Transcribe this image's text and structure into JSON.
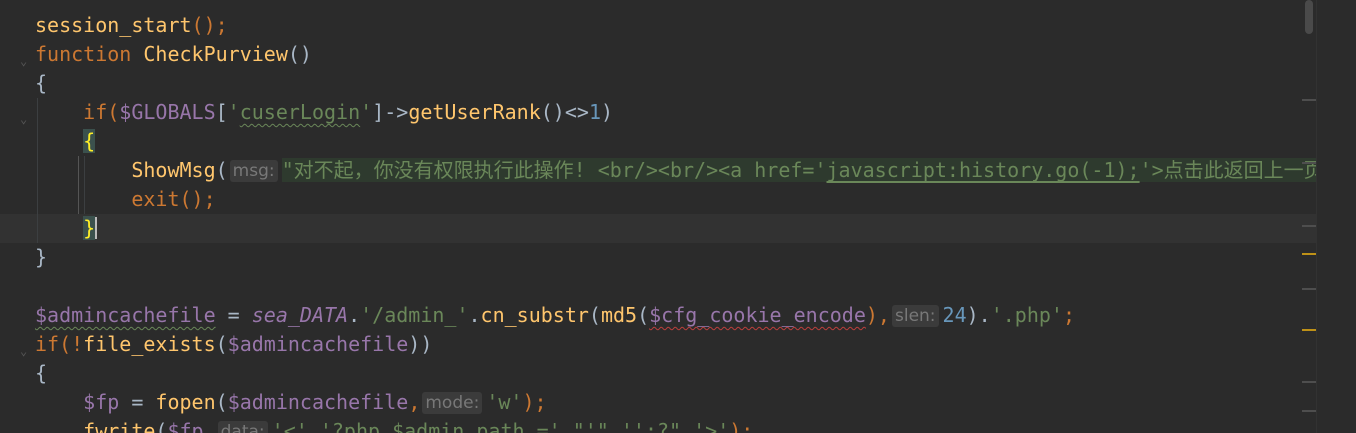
{
  "editor": {
    "lines": [
      {
        "tokens": [
          {
            "t": "session_start",
            "c": "fn"
          },
          {
            "t": "();",
            "c": "kw"
          }
        ]
      },
      {
        "tokens": [
          {
            "t": "function ",
            "c": "kw"
          },
          {
            "t": "CheckPurview",
            "c": "fn"
          },
          {
            "t": "()",
            "c": "pl"
          }
        ]
      },
      {
        "tokens": [
          {
            "t": "{",
            "c": "pl"
          }
        ]
      },
      {
        "tokens": [
          {
            "t": "    if(",
            "c": "kw"
          },
          {
            "t": "$GLOBALS",
            "c": "var"
          },
          {
            "t": "[",
            "c": "pl"
          },
          {
            "t": "'",
            "c": "str"
          },
          {
            "t": "cuserLogin",
            "c": "str squig"
          },
          {
            "t": "'",
            "c": "str"
          },
          {
            "t": "]->",
            "c": "pl"
          },
          {
            "t": "getUserRank",
            "c": "fn"
          },
          {
            "t": "()<>",
            "c": "pl"
          },
          {
            "t": "1",
            "c": "num"
          },
          {
            "t": ")",
            "c": "pl"
          }
        ]
      },
      {
        "tokens": [
          {
            "t": "    ",
            "c": "pl"
          },
          {
            "t": "{",
            "c": "brace-hl"
          }
        ]
      },
      {
        "tokens": [
          {
            "t": "        ShowMsg",
            "c": "fn"
          },
          {
            "t": "(",
            "c": "pl"
          },
          {
            "hint": "msg:"
          },
          {
            "t": "\"对不起，你没有权限执行此操作! <br/><br/><a href='",
            "c": "str strbg"
          },
          {
            "t": "javascript:history.go(-1);",
            "c": "str strbg uline"
          },
          {
            "t": "'>点击此返回上一页",
            "c": "str strbg"
          }
        ]
      },
      {
        "tokens": [
          {
            "t": "        exit",
            "c": "kw"
          },
          {
            "t": "();",
            "c": "kw"
          }
        ]
      },
      {
        "tokens": [
          {
            "t": "    ",
            "c": "pl"
          },
          {
            "t": "}",
            "c": "brace-hl"
          },
          {
            "caret": true
          }
        ],
        "current": true
      },
      {
        "tokens": [
          {
            "t": "}",
            "c": "pl"
          }
        ]
      },
      {
        "tokens": []
      },
      {
        "tokens": [
          {
            "t": "$admincachefile",
            "c": "var squig"
          },
          {
            "t": " = ",
            "c": "pl"
          },
          {
            "t": "sea_DATA",
            "c": "var italic"
          },
          {
            "t": ".",
            "c": "pl"
          },
          {
            "t": "'/admin_'",
            "c": "str"
          },
          {
            "t": ".",
            "c": "pl"
          },
          {
            "t": "cn_substr",
            "c": "fn"
          },
          {
            "t": "(",
            "c": "pl"
          },
          {
            "t": "md5",
            "c": "fn"
          },
          {
            "t": "(",
            "c": "pl"
          },
          {
            "t": "$cfg_cookie_encode",
            "c": "var squigr"
          },
          {
            "t": "),",
            "c": "kw"
          },
          {
            "hint": "slen:"
          },
          {
            "t": "24",
            "c": "num"
          },
          {
            "t": ").",
            "c": "pl"
          },
          {
            "t": "'.php'",
            "c": "str"
          },
          {
            "t": ";",
            "c": "kw"
          }
        ]
      },
      {
        "tokens": [
          {
            "t": "if(!",
            "c": "kw"
          },
          {
            "t": "file_exists",
            "c": "fn"
          },
          {
            "t": "(",
            "c": "pl"
          },
          {
            "t": "$admincachefile",
            "c": "var"
          },
          {
            "t": "))",
            "c": "pl"
          }
        ]
      },
      {
        "tokens": [
          {
            "t": "{",
            "c": "pl"
          }
        ]
      },
      {
        "tokens": [
          {
            "t": "    ",
            "c": "pl"
          },
          {
            "t": "$fp",
            "c": "var"
          },
          {
            "t": " = ",
            "c": "pl"
          },
          {
            "t": "fopen",
            "c": "fn"
          },
          {
            "t": "(",
            "c": "pl"
          },
          {
            "t": "$admincachefile",
            "c": "var"
          },
          {
            "t": ",",
            "c": "kw"
          },
          {
            "hint": "mode:"
          },
          {
            "t": "'w'",
            "c": "str"
          },
          {
            "t": ");",
            "c": "kw"
          }
        ]
      },
      {
        "tokens": [
          {
            "t": "    ",
            "c": "pl"
          },
          {
            "t": "fwrite",
            "c": "fn"
          },
          {
            "t": "(",
            "c": "pl"
          },
          {
            "t": "$fp",
            "c": "var"
          },
          {
            "t": ",",
            "c": "kw"
          },
          {
            "hint": "data:"
          },
          {
            "t": "'<'.'?php $admin_path ='.\"'\".'';?\".'>'",
            "c": "str"
          },
          {
            "t": ");",
            "c": "kw"
          }
        ]
      }
    ]
  },
  "colors": {
    "background": "#2b2b2b",
    "keyword": "#cc7832",
    "function": "#ffc66d",
    "variable": "#9876aa",
    "string": "#6a8759",
    "number": "#6897bb",
    "plain": "#a9b7c6"
  },
  "scrollbar": {
    "marks": [
      {
        "color": "#4e4e4e"
      },
      {
        "color": "#4e4e4e"
      },
      {
        "color": "#4e4e4e"
      },
      {
        "color": "#be9117"
      },
      {
        "color": "#4e4e4e"
      },
      {
        "color": "#be9117"
      },
      {
        "color": "#4e4e4e"
      },
      {
        "color": "#4e4e4e"
      }
    ]
  }
}
